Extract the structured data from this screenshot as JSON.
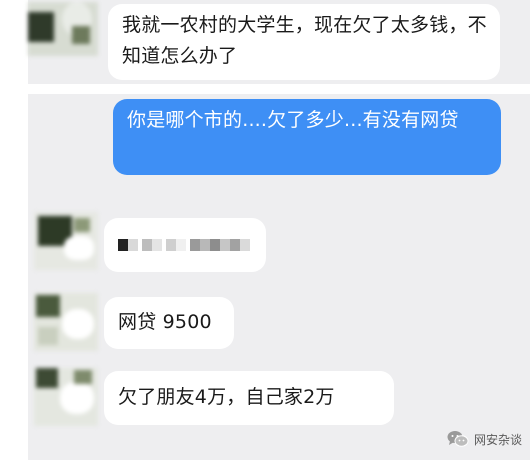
{
  "messages": [
    {
      "side": "in",
      "text": "我就一农村的大学生，现在欠了太多钱，不知道怎么办了"
    },
    {
      "side": "out",
      "text": "你是哪个市的....欠了多少...有没有网贷"
    },
    {
      "side": "in",
      "text": "",
      "redacted": true
    },
    {
      "side": "in",
      "text": "网贷 9500"
    },
    {
      "side": "in",
      "text": "欠了朋友4万，自己家2万"
    }
  ],
  "watermark": {
    "label": "网安杂谈",
    "icon": "wechat-icon"
  },
  "colors": {
    "chat_background": "#eeeef0",
    "incoming_bubble": "#ffffff",
    "outgoing_bubble": "#3e8ff5"
  }
}
